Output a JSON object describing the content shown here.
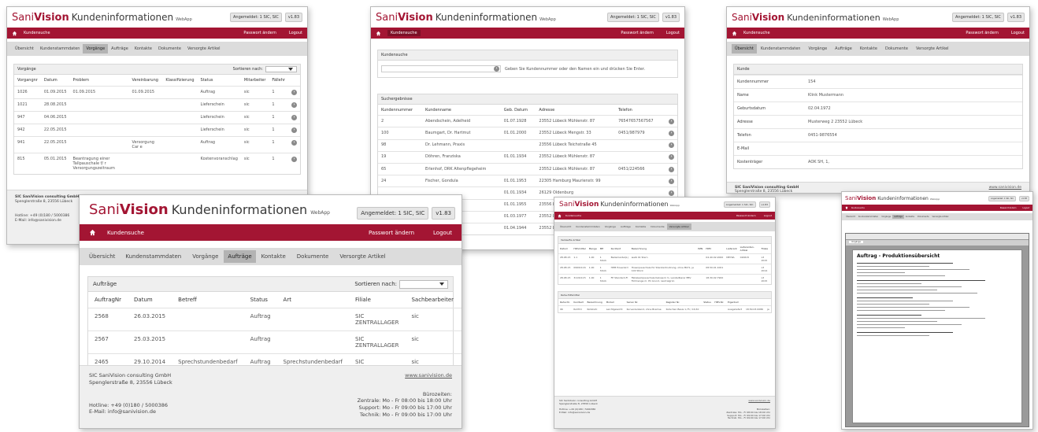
{
  "brand": {
    "a": "Sani",
    "b": "Vision",
    "c": "Kundeninformationen",
    "d": "WebApp"
  },
  "user_label": "Angemeldet: 1 SIC, SIC",
  "version": "v1.83",
  "home_label": "Kundensuche",
  "password_label": "Passwort ändern",
  "logout_label": "Logout",
  "nav": [
    "Übersicht",
    "Kundenstammdaten",
    "Vorgänge",
    "Aufträge",
    "Kontakte",
    "Dokumente",
    "Versorgte Artikel"
  ],
  "sort_label": "Sortieren nach:",
  "footer": {
    "company": "SIC SaniVision consulting GmbH",
    "street": "Spenglerstraße 8, 23556 Lübeck",
    "hotline": "Hotline: +49 (0)180 / 5000386",
    "email": "E-Mail: info@sanivision.de",
    "url": "www.sanivision.de",
    "hours_title": "Bürozeiten:",
    "hours": [
      "Zentrale: Mo - Fr 08:00 bis 18:00 Uhr",
      "Support: Mo - Fr 09:00 bis 17:00 Uhr",
      "Technik: Mo - Fr 09:00 bis 17:00 Uhr"
    ]
  },
  "vorgaenge": {
    "title": "Vorgänge",
    "columns": [
      "Vorgangnr",
      "Datum",
      "Problem",
      "Vereinbarung",
      "Klassifizierung",
      "Status",
      "Mitarbeiter",
      "Fällehr"
    ],
    "rows": [
      [
        "1026",
        "01.09.2015",
        "01.09.2015",
        "01.09.2015",
        "",
        "Auftrag",
        "sic",
        "1"
      ],
      [
        "1021",
        "28.08.2015",
        "",
        "",
        "",
        "Lieferschein",
        "sic",
        "1"
      ],
      [
        "947",
        "04.06.2015",
        "",
        "",
        "",
        "Lieferschein",
        "sic",
        "1"
      ],
      [
        "942",
        "22.05.2015",
        "",
        "",
        "",
        "Lieferschein",
        "sic",
        "1"
      ],
      [
        "941",
        "22.05.2015",
        "",
        "Versorgung Car e",
        "",
        "Auftrag",
        "sic",
        "1"
      ],
      [
        "815",
        "05.01.2015",
        "Beantragung einer Tallpauschale f/ r Versorgungszeitraum",
        "",
        "",
        "Kostenvoranschlag",
        "sic",
        "1"
      ]
    ]
  },
  "search": {
    "title": "Kundensuche",
    "hint": "Geben Sie Kundennummer oder den Namen ein und drücken Sie Enter.",
    "results_title": "Suchergebnisse",
    "columns": [
      "Kundennummer",
      "Kundenname",
      "Geb. Datum",
      "Adresse",
      "Telefon"
    ],
    "rows": [
      [
        "2",
        "Abendschein, Adelheid",
        "01.07.1928",
        "23552 Lübeck Mühlenstr. 87",
        "76547657567567"
      ],
      [
        "100",
        "Baumgart, Dr. Hartmut",
        "01.01.2000",
        "23552 Lübeck Mengstr. 33",
        "0451/987979"
      ],
      [
        "98",
        "Dr. Lehmann, Praxis",
        "",
        "23556 Lübeck Teichstraße 45",
        ""
      ],
      [
        "19",
        "Döhren, Franziska",
        "01.01.1934",
        "23552 Lübeck Mühlenstr. 87",
        ""
      ],
      [
        "65",
        "Erlenhof, DRK Altenpflegeheim",
        "",
        "23552 Lübeck Mühlenstr. 87",
        "0451/224566"
      ],
      [
        "24",
        "Fischer, Gondula",
        "01.01.1953",
        "22305 Hamburg Maurienstr. 99",
        ""
      ],
      [
        "",
        "",
        "01.01.1934",
        "26129 Oldenburg",
        ""
      ],
      [
        "",
        "",
        "01.01.1955",
        "23556 Lübeck",
        ""
      ],
      [
        "",
        "",
        "01.03.1977",
        "23552 Lübeck",
        ""
      ],
      [
        "",
        "",
        "01.04.1944",
        "23552 Lübeck",
        ""
      ]
    ]
  },
  "kunde": {
    "title": "Kunde",
    "rows": [
      [
        "Kundennummer",
        "154"
      ],
      [
        "Name",
        "Klink Mustermann"
      ],
      [
        "Geburtsdatum",
        "02.04.1972"
      ],
      [
        "Adresse",
        "Musterweg 2 23552 Lübeck"
      ],
      [
        "Telefon",
        "0451-9876554"
      ],
      [
        "E-Mail",
        ""
      ],
      [
        "Kostenträger",
        "AOK SH, 1,"
      ]
    ]
  },
  "auftraege": {
    "title": "Aufträge",
    "columns": [
      "AuftragNr",
      "Datum",
      "Betreff",
      "Status",
      "Art",
      "Filiale",
      "Sachbearbeiter"
    ],
    "rows": [
      [
        "2568",
        "26.03.2015",
        "",
        "Auftrag",
        "",
        "SIC ZENTRALLAGER",
        "sic"
      ],
      [
        "2567",
        "25.03.2015",
        "",
        "Auftrag",
        "",
        "SIC ZENTRALLAGER",
        "sic"
      ],
      [
        "2465",
        "29.10.2014",
        "Sprechstundenbedarf",
        "Auftrag",
        "Sprechstundenbedarf",
        "SIC ZENTRALLAGER",
        "sic"
      ]
    ]
  },
  "versorgte": {
    "active_tab": "Versorgte Artikel",
    "sec1": "Verkaufte Artikel",
    "cols1": [
      "Datum",
      "Hilfsmittel",
      "Menge",
      "ME",
      "Kurztext",
      "Bezeichnung",
      "PZN",
      "HMV",
      "Lieferant",
      "Lieferanten-Artikel",
      "Filiale"
    ],
    "rows1": [
      [
        "28.08.15",
        "1.1",
        "1.00",
        "1 Stück",
        "Bademantel(L)",
        "weiß 01 Stern",
        "",
        "04.40.02.2000",
        "MEYRA",
        "020615",
        "L3 2015"
      ],
      [
        "28.08.15",
        "09991116",
        "1.00",
        "1 Stück",
        "HPM Hosenbrd",
        "Hosenpauschale für Standardnutzung, ohne MLT1, je 100 Stück",
        "",
        "08.50.01.1001",
        "",
        "",
        "L3 2014"
      ],
      [
        "28.08.15",
        "31191115",
        "1.00",
        "1 Stück",
        "FP Standard-Fl",
        "Fäkalsackpauschale Kalosack m. verstellbarer EBV Füllmenge m. Pö Grund, neutralgrün",
        "",
        "18.30.02.7900",
        "",
        "",
        "L3 2015"
      ]
    ],
    "sec2": "Reha-Hilfsmittel",
    "cols2": [
      "Reha Nr.",
      "Kurztext",
      "Bezeichnung",
      "Modell",
      "Serien Nr.",
      "Register Nr.",
      "Status",
      "HMV-Nr.",
      "Eigentum"
    ],
    "rows2": [
      [
        "96",
        "Roll?Dr",
        "Rollstuhl",
        " Leichtgewicht",
        "Kurvenlenkend, ohne Bremse",
        "Kutschen Basis 1,75 / 16,50",
        "",
        "",
        "Ausgeliefert",
        "18.50.03.0086",
        "ja"
      ]
    ]
  },
  "druck": {
    "title": "Auftrag - Produktionsübersicht",
    "tab": "Vorgänge"
  }
}
